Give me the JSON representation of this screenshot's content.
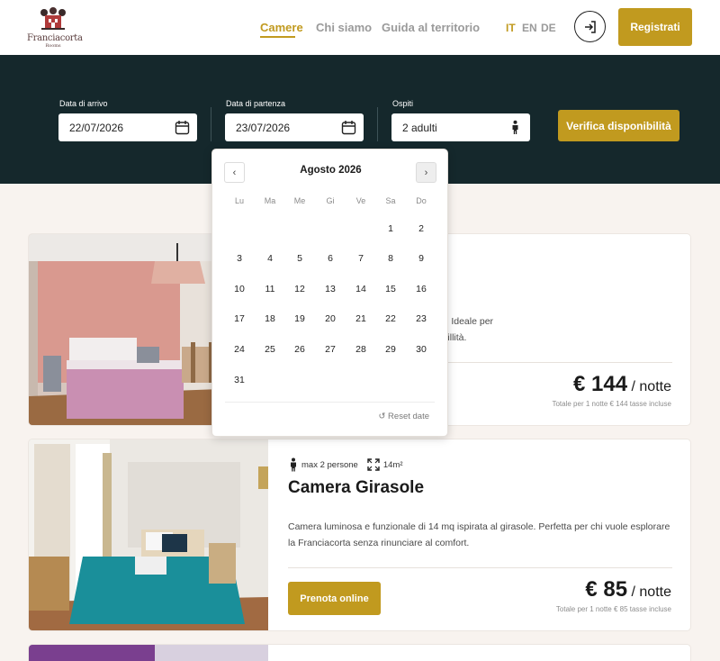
{
  "brand": {
    "name": "Franciacorta",
    "tagline": "Rooms"
  },
  "nav": {
    "items": [
      {
        "label": "Camere"
      },
      {
        "label": "Chi siamo"
      },
      {
        "label": "Guida al territorio"
      }
    ]
  },
  "languages": [
    "IT",
    "EN",
    "DE"
  ],
  "header": {
    "register_label": "Registrati",
    "login_icon": "login-icon"
  },
  "search": {
    "arrival": {
      "label": "Data di arrivo",
      "value": "22/07/2026",
      "icon": "calendar-icon"
    },
    "departure": {
      "label": "Data di partenza",
      "value": "23/07/2026",
      "icon": "calendar-icon"
    },
    "guests": {
      "label": "Ospiti",
      "value": "2 adulti",
      "icon": "person-icon"
    },
    "check_label": "Verifica disponibilità"
  },
  "calendar": {
    "month_label": "Agosto 2026",
    "weekdays": [
      "Lu",
      "Ma",
      "Me",
      "Gi",
      "Ve",
      "Sa",
      "Do"
    ],
    "weeks": [
      [
        "",
        "",
        "",
        "",
        "",
        "1",
        "2"
      ],
      [
        "3",
        "4",
        "5",
        "6",
        "7",
        "8",
        "9"
      ],
      [
        "10",
        "11",
        "12",
        "13",
        "14",
        "15",
        "16"
      ],
      [
        "17",
        "18",
        "19",
        "20",
        "21",
        "22",
        "23"
      ],
      [
        "24",
        "25",
        "26",
        "27",
        "28",
        "29",
        "30"
      ],
      [
        "31",
        "",
        "",
        "",
        "",
        "",
        ""
      ]
    ],
    "reset_label": "↺ Reset date",
    "prev_label": "‹",
    "next_label": "›"
  },
  "rooms": [
    {
      "description": "con arredi caldi e affaccio sul giardino. Ideale per\ne la Franciacorta con comfort e tranquillità.",
      "price": "€ 144",
      "price_unit": "/ notte",
      "price_note": "Totale per 1 notte € 144   tasse incluse"
    },
    {
      "capacity": "max 2 persone",
      "size": "14m²",
      "title": "Camera Girasole",
      "description": "Camera luminosa e funzionale di 14 mq ispirata al girasole. Perfetta per chi vuole esplorare la Franciacorta senza rinunciare al comfort.",
      "book_label": "Prenota online",
      "price": "€ 85",
      "price_unit": "/ notte",
      "price_note": "Totale per 1 notte € 85   tasse incluse"
    }
  ],
  "colors": {
    "accent": "#c19a1f",
    "band": "#15282c",
    "background": "#f8f3ef"
  }
}
